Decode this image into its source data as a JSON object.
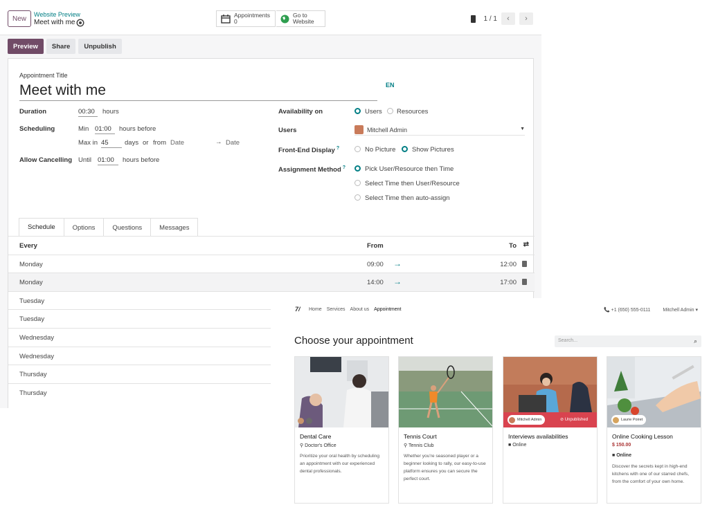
{
  "topbar": {
    "new_label": "New",
    "breadcrumb": "Website Preview",
    "record_title": "Meet with me",
    "appointments_label": "Appointments",
    "appointments_count": "0",
    "goto_line1": "Go to",
    "goto_line2": "Website",
    "pager_text": "1 / 1"
  },
  "actions": {
    "preview": "Preview",
    "share": "Share",
    "unpublish": "Unpublish"
  },
  "form": {
    "title_label": "Appointment Title",
    "title_value": "Meet with me",
    "lang": "EN",
    "duration_label": "Duration",
    "duration_value": "00:30",
    "duration_unit": "hours",
    "scheduling_label": "Scheduling",
    "min_label": "Min",
    "min_value": "01:00",
    "min_unit": "hours before",
    "max_label": "Max in",
    "max_value": "45",
    "max_unit": "days",
    "or_label": "or",
    "from_label": "from",
    "date_from_placeholder": "Date",
    "date_arrow": "→",
    "date_to_placeholder": "Date",
    "cancel_label": "Allow Cancelling",
    "until_label": "Until",
    "cancel_value": "01:00",
    "cancel_unit": "hours before",
    "availability_label": "Availability on",
    "availability_options": [
      "Users",
      "Resources"
    ],
    "users_label": "Users",
    "users_value": "Mitchell Admin",
    "frontend_label": "Front-End Display",
    "frontend_options": [
      "No Picture",
      "Show Pictures"
    ],
    "assignment_label": "Assignment Method",
    "assignment_options": [
      "Pick User/Resource then Time",
      "Select Time then User/Resource",
      "Select Time then auto-assign"
    ],
    "help_mark": "?"
  },
  "tabs": [
    "Schedule",
    "Options",
    "Questions",
    "Messages"
  ],
  "schedule": {
    "headers": [
      "Every",
      "From",
      "To"
    ],
    "rows": [
      {
        "day": "Monday",
        "from": "09:00",
        "to": "12:00"
      },
      {
        "day": "Monday",
        "from": "14:00",
        "to": "17:00"
      },
      {
        "day": "Tuesday",
        "from": "",
        "to": ""
      },
      {
        "day": "Tuesday",
        "from": "",
        "to": ""
      },
      {
        "day": "Wednesday",
        "from": "",
        "to": ""
      },
      {
        "day": "Wednesday",
        "from": "",
        "to": ""
      },
      {
        "day": "Thursday",
        "from": "",
        "to": ""
      },
      {
        "day": "Thursday",
        "from": "",
        "to": ""
      }
    ]
  },
  "website": {
    "nav": [
      "Home",
      "Services",
      "About us",
      "Appointment"
    ],
    "phone": "+1 (650) 555-0111",
    "user": "Mitchell Admin",
    "heading": "Choose your appointment",
    "search_placeholder": "Search...",
    "cards": [
      {
        "name": "Dental Care",
        "location": "Doctor's Office",
        "description": "Prioritize your oral health by scheduling an appointment with our experienced dental professionals."
      },
      {
        "name": "Tennis Court",
        "location": "Tennis Club",
        "description": "Whether you're seasoned player or a beginner looking to rally, our easy-to-use platform ensures you can secure the perfect court."
      },
      {
        "name": "Interviews availabilities",
        "location": "Online",
        "badge_user": "Mitchell Admin",
        "badge_status": "Unpublished"
      },
      {
        "name": "Online Cooking Lesson",
        "price": "$ 150.00",
        "location": "Online",
        "badge_user": "Laurie Poiret",
        "description": "Discover the secrets kept in high-end kitchens with one of our starred chefs, from the comfort of your own home."
      }
    ]
  },
  "colors": {
    "brand": "#714b67",
    "accent": "#017e84",
    "unpublished": "#d9434f"
  }
}
